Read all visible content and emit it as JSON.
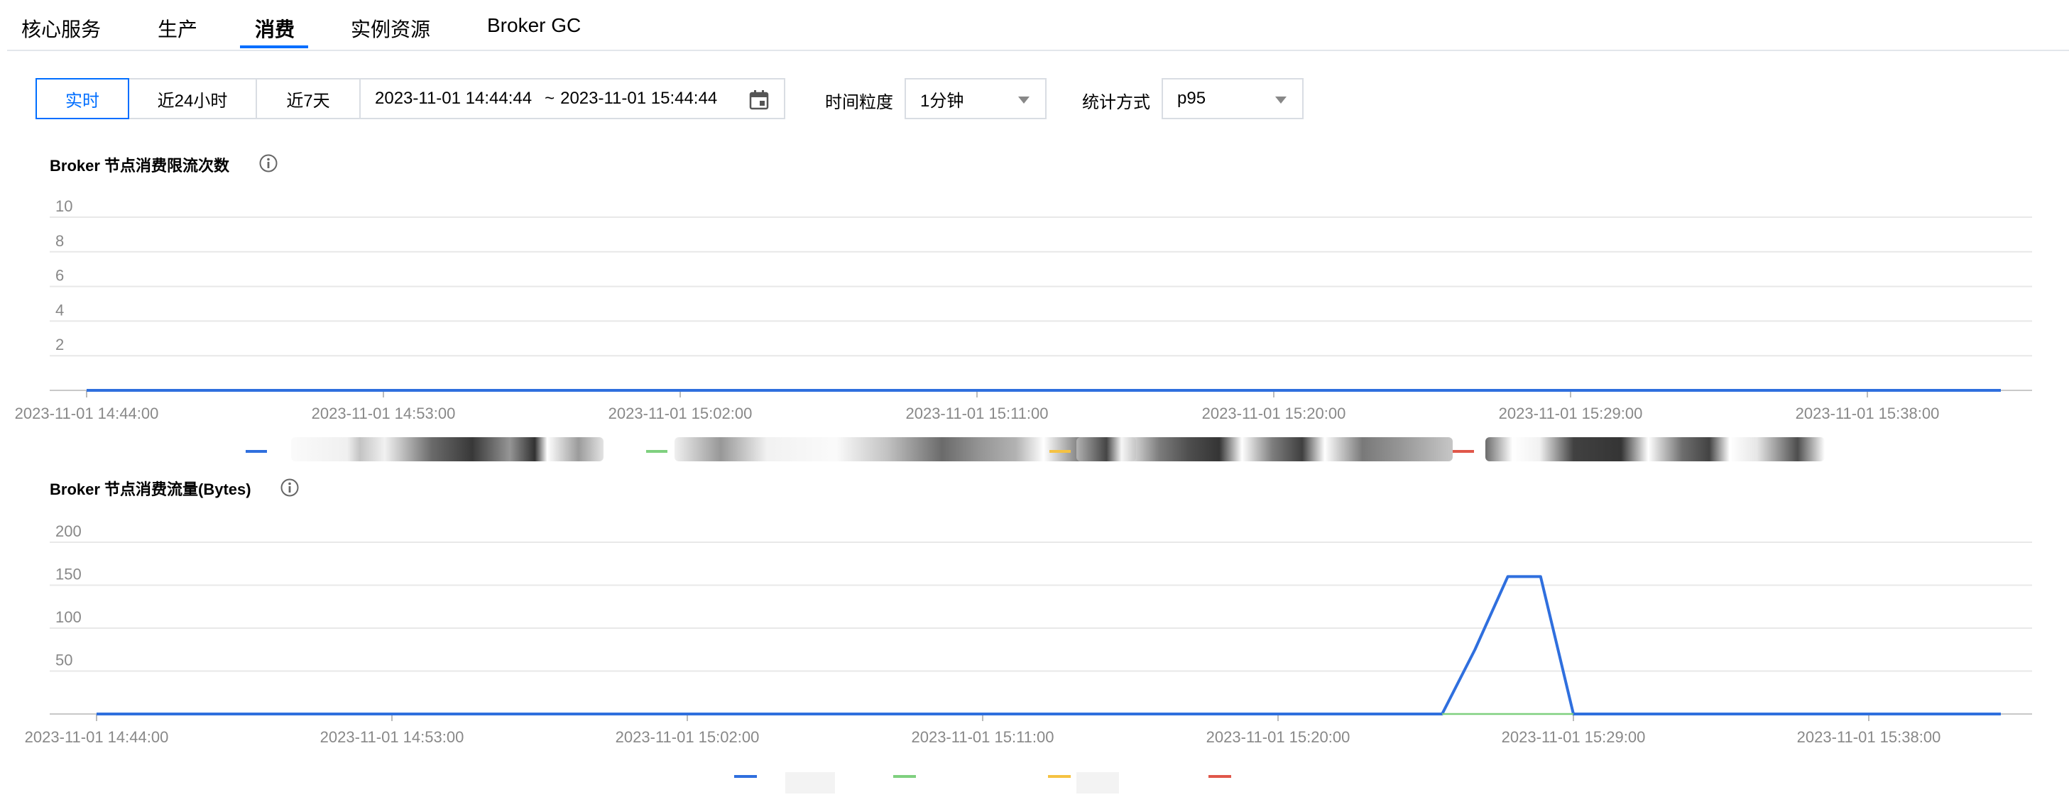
{
  "tabs": [
    {
      "label": "核心服务",
      "active": false
    },
    {
      "label": "生产",
      "active": false
    },
    {
      "label": "消费",
      "active": true
    },
    {
      "label": "实例资源",
      "active": false
    },
    {
      "label": "Broker GC",
      "active": false
    }
  ],
  "toolbar": {
    "time_buttons": [
      {
        "label": "实时",
        "active": true
      },
      {
        "label": "近24小时",
        "active": false
      },
      {
        "label": "近7天",
        "active": false
      }
    ],
    "date_start": "2023-11-01 14:44:44",
    "date_separator": "~",
    "date_end": "2023-11-01 15:44:44",
    "granularity_label": "时间粒度",
    "granularity_value": "1分钟",
    "stat_label": "统计方式",
    "stat_value": "p95"
  },
  "colors": {
    "accent": "#006eff",
    "series": [
      "#2f6fde",
      "#7fd07f",
      "#f5c242",
      "#e0574a"
    ],
    "grid": "#e8e8e8"
  },
  "chart_data": [
    {
      "type": "line",
      "title": "Broker 节点消费限流次数",
      "x": [
        "2023-11-01 14:44:00",
        "2023-11-01 14:53:00",
        "2023-11-01 15:02:00",
        "2023-11-01 15:11:00",
        "2023-11-01 15:20:00",
        "2023-11-01 15:29:00",
        "2023-11-01 15:38:00"
      ],
      "y_ticks": [
        "2",
        "4",
        "6",
        "8",
        "10"
      ],
      "ylim": [
        0,
        10
      ],
      "series": [
        {
          "color": "#2f6fde",
          "values": [
            0,
            0,
            0,
            0,
            0,
            0,
            0
          ]
        }
      ],
      "grid": true,
      "legend": "bottom"
    },
    {
      "type": "line",
      "title": "Broker 节点消费流量(Bytes)",
      "x": [
        "2023-11-01 14:44:00",
        "2023-11-01 14:53:00",
        "2023-11-01 15:02:00",
        "2023-11-01 15:11:00",
        "2023-11-01 15:20:00",
        "2023-11-01 15:29:00",
        "2023-11-01 15:38:00"
      ],
      "y_ticks": [
        "50",
        "100",
        "150",
        "200"
      ],
      "ylim": [
        0,
        200
      ],
      "series": [
        {
          "color": "#2f6fde",
          "points": [
            [
              "14:44",
              0
            ],
            [
              "15:25",
              0
            ],
            [
              "15:26",
              75
            ],
            [
              "15:27",
              160
            ],
            [
              "15:28",
              160
            ],
            [
              "15:29",
              0
            ],
            [
              "15:44",
              0
            ]
          ]
        },
        {
          "color": "#7fd07f",
          "points": [
            [
              "15:25",
              0
            ],
            [
              "15:29",
              0
            ]
          ]
        }
      ],
      "grid": true,
      "legend": "bottom"
    }
  ]
}
